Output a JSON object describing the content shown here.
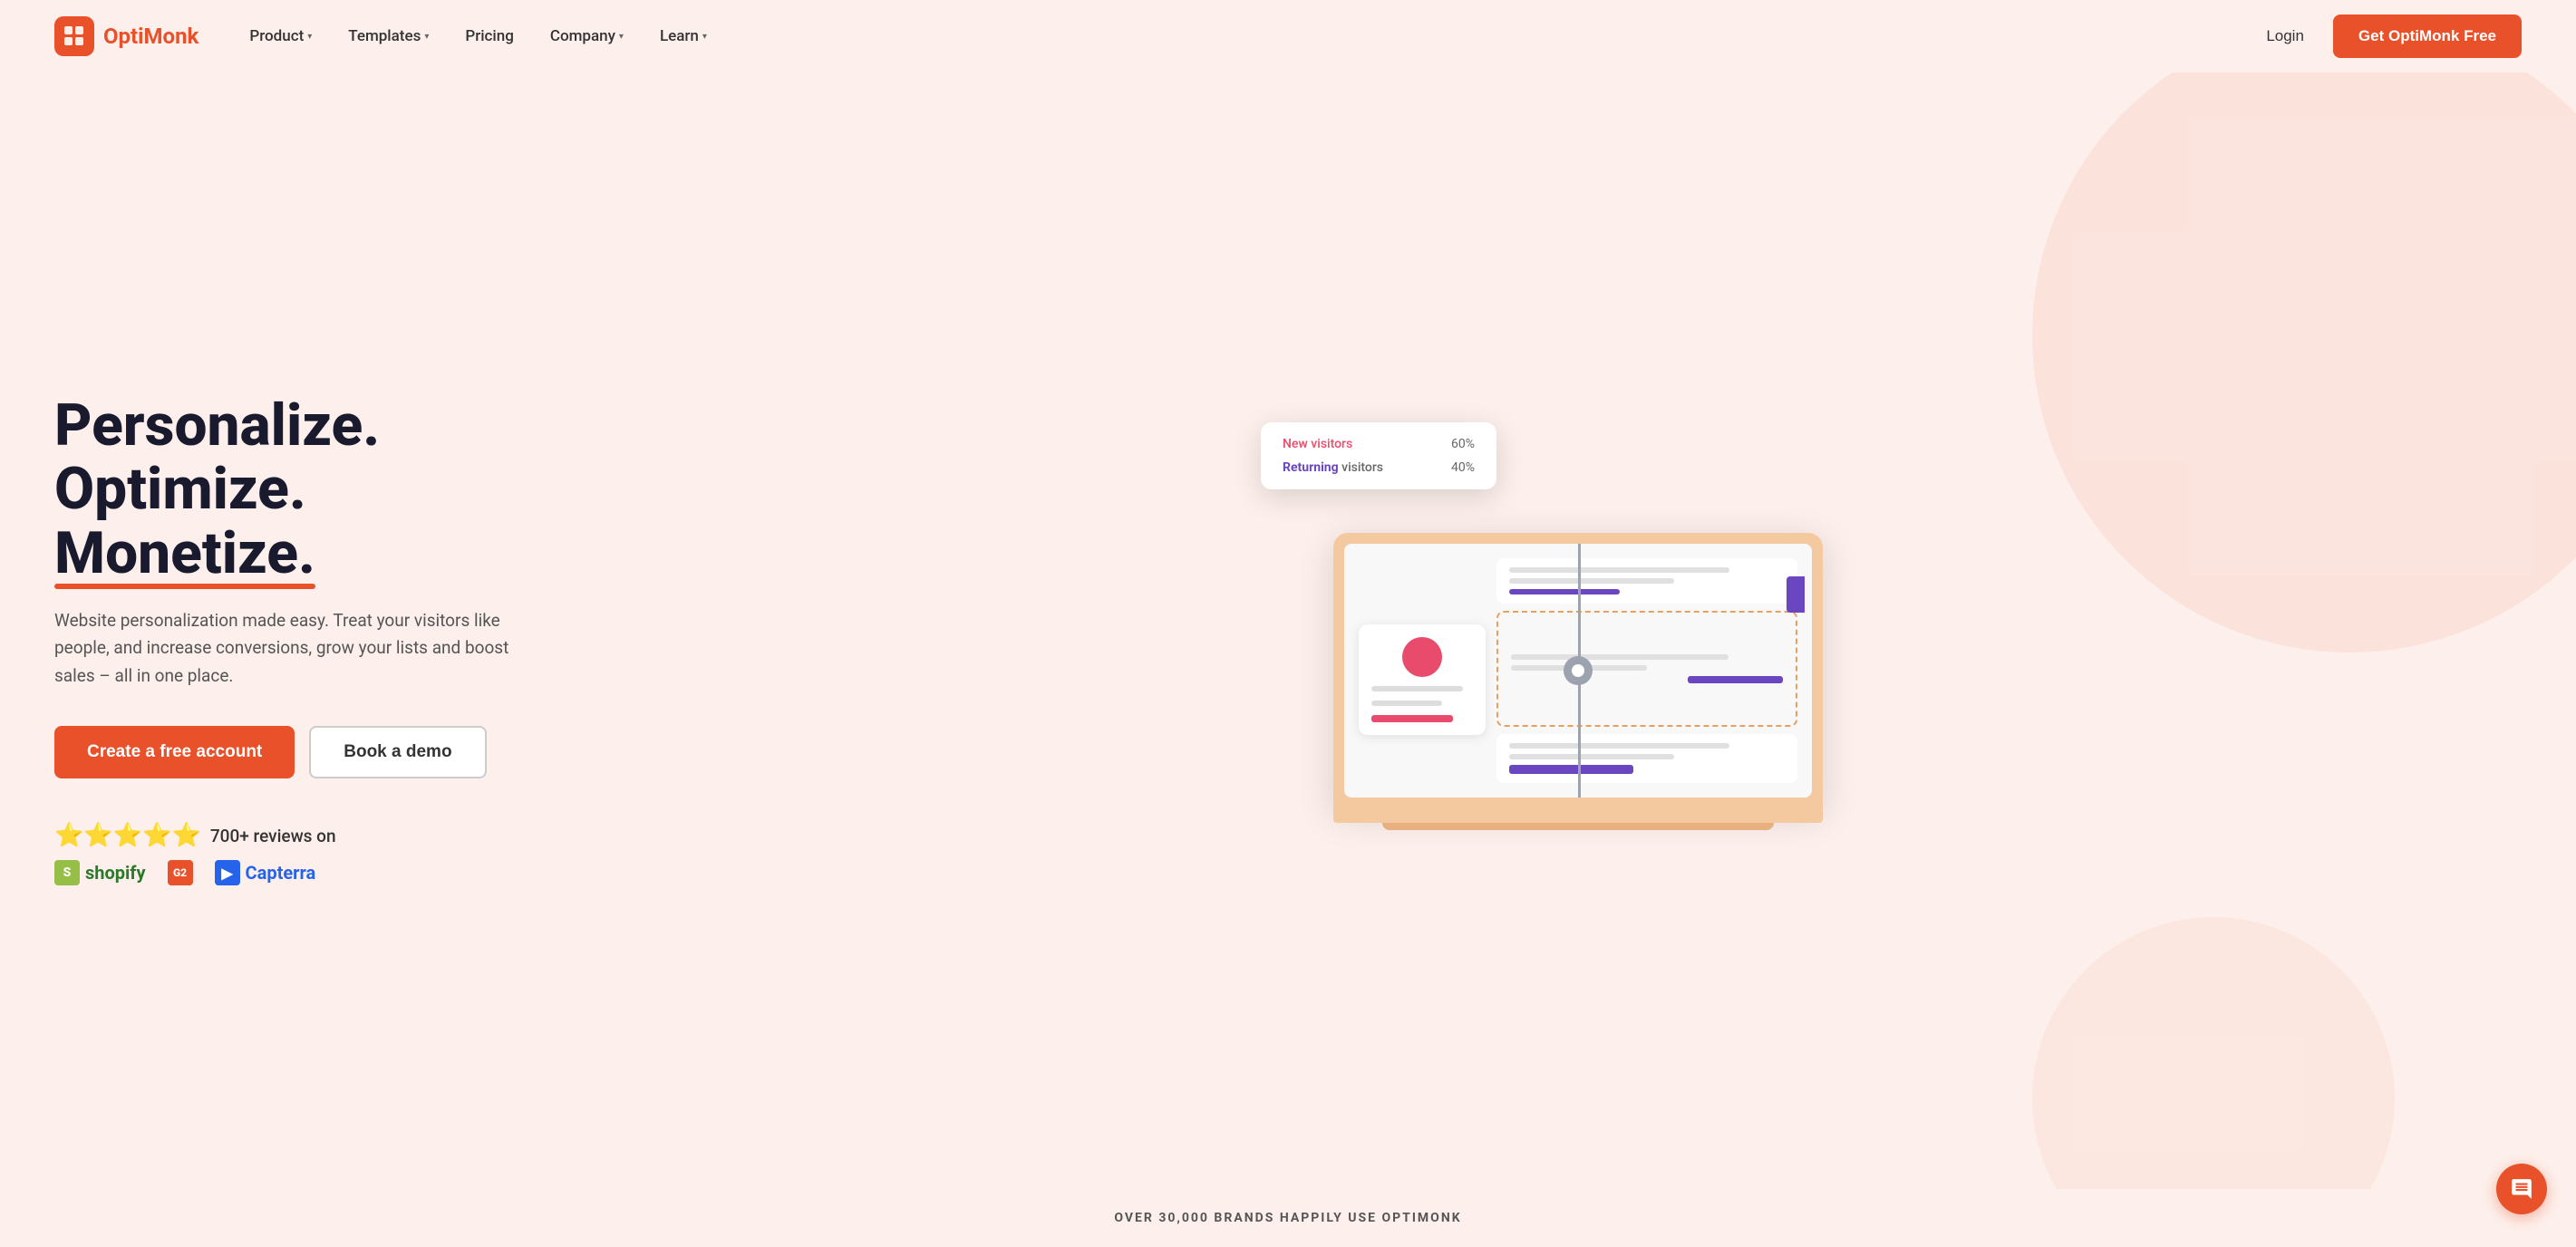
{
  "brand": {
    "name_part1": "Opti",
    "name_part2": "Monk",
    "logo_alt": "OptiMonk logo"
  },
  "nav": {
    "product_label": "Product",
    "templates_label": "Templates",
    "pricing_label": "Pricing",
    "company_label": "Company",
    "learn_label": "Learn",
    "login_label": "Login",
    "cta_label": "Get OptiMonk Free"
  },
  "hero": {
    "title_line1": "Personalize. Optimize.",
    "title_line2": "Monetize.",
    "subtitle": "Website personalization made easy. Treat your visitors like people, and increase conversions, grow your lists and boost sales – all in one place.",
    "btn_primary": "Create a free account",
    "btn_secondary": "Book a demo",
    "stars": "⭐⭐⭐⭐⭐",
    "reviews_text": "700+ reviews on",
    "platform1": "shopify",
    "platform2": "G2",
    "platform3": "Capterra"
  },
  "illustration": {
    "tooltip_new_label": "New",
    "tooltip_new_suffix": " visitors",
    "tooltip_new_value": "60%",
    "tooltip_returning_label": "Returning",
    "tooltip_returning_suffix": " visitors",
    "tooltip_returning_value": "40%"
  },
  "bottom_bar": {
    "text": "OVER 30,000 BRANDS HAPPILY USE OPTIMONK"
  },
  "colors": {
    "primary": "#e8512a",
    "purple": "#6b46c1",
    "background": "#fdf0ec"
  }
}
